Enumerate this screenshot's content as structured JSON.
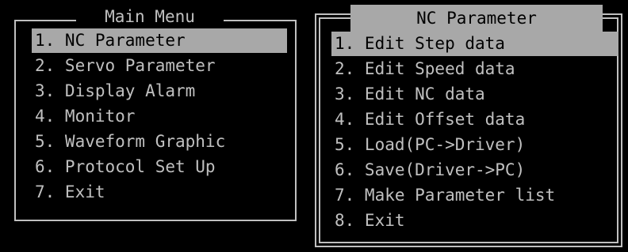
{
  "colors": {
    "background": "#000000",
    "text": "#c0c0c0",
    "highlight": "#a8a8a8",
    "highlight_text": "#000000"
  },
  "main_menu": {
    "title": "Main Menu",
    "items": [
      {
        "label": "1. NC Parameter",
        "selected": true
      },
      {
        "label": "2. Servo Parameter",
        "selected": false
      },
      {
        "label": "3. Display Alarm",
        "selected": false
      },
      {
        "label": "4. Monitor",
        "selected": false
      },
      {
        "label": "5. Waveform Graphic",
        "selected": false
      },
      {
        "label": "6. Protocol Set Up",
        "selected": false
      },
      {
        "label": "7. Exit",
        "selected": false
      }
    ]
  },
  "nc_parameter": {
    "title": "NC Parameter",
    "items": [
      {
        "label": "1. Edit Step data",
        "selected": true
      },
      {
        "label": "2. Edit Speed data",
        "selected": false
      },
      {
        "label": "3. Edit NC data",
        "selected": false
      },
      {
        "label": "4. Edit Offset data",
        "selected": false
      },
      {
        "label": "5. Load(PC->Driver)",
        "selected": false
      },
      {
        "label": "6. Save(Driver->PC)",
        "selected": false
      },
      {
        "label": "7. Make Parameter list",
        "selected": false
      },
      {
        "label": "8. Exit",
        "selected": false
      }
    ]
  }
}
